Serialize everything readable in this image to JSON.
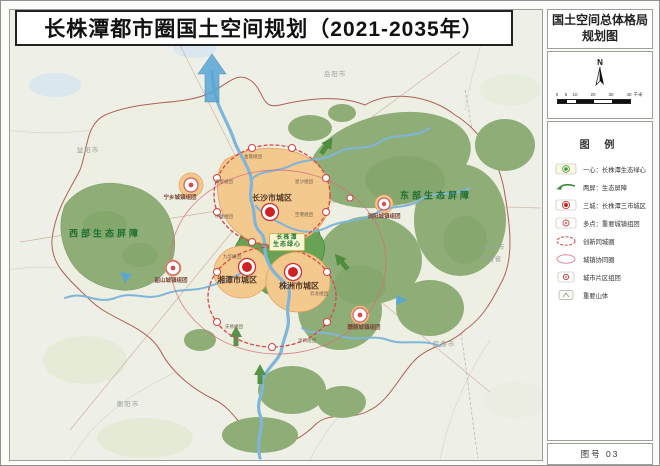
{
  "title": "长株潭都市圈国土空间规划（2021-2035年）",
  "sidebar": {
    "map_title": "国土空间总体格局规划图",
    "north_label": "N",
    "scale": {
      "ticks": [
        "0",
        "5",
        "10",
        "20",
        "30",
        "40"
      ],
      "unit": "千米"
    },
    "legend": {
      "title": "图 例",
      "items": [
        {
          "icon": "eco-core-dot-icon",
          "label": "一心：长株潭生态绿心"
        },
        {
          "icon": "eco-barrier-arrow-icon",
          "label": "两屏：生态屏障"
        },
        {
          "icon": "city-dot-icon",
          "label": "三城：长株潭三市城区"
        },
        {
          "icon": "town-ring-icon",
          "label": "多点：重要城镇组团"
        },
        {
          "icon": "innovation-circle-icon",
          "label": "创新同城圈"
        },
        {
          "icon": "synergy-circle-icon",
          "label": "城镇协同圈"
        },
        {
          "icon": "district-ring-icon",
          "label": "城市片区组团"
        },
        {
          "icon": "mountain-box-icon",
          "label": "重要山体"
        }
      ]
    },
    "figure_label": "图号 03"
  },
  "map": {
    "cities": [
      "长沙市城区",
      "湘潭市城区",
      "株洲市城区"
    ],
    "eco_core": {
      "line1": "长株潭",
      "line2": "生态绿心"
    },
    "barriers": [
      "西部生态屏障",
      "东部生态屏障"
    ],
    "town_clusters": [
      "宁乡城镇组团",
      "韶山城镇组团",
      "浏阳城镇组团",
      "醴陵城镇组团"
    ],
    "sub_districts": [
      "金霞组团",
      "高星组团",
      "星沙组团",
      "空港组团",
      "坪塘组团",
      "九华组团",
      "云龙组团",
      "天易组团",
      "渌口组团"
    ],
    "neighbor_labels": [
      "益阳市",
      "岳阳市",
      "九江市",
      "江西省",
      "宜春市",
      "衡阳市"
    ]
  },
  "colors": {
    "barrier_green": "#8fae77",
    "eco_core_green": "#68a355",
    "urban_orange": "#f4c98e",
    "ring_red": "#d84848",
    "river_blue": "#7fb5da",
    "boundary_red": "#b06055"
  }
}
